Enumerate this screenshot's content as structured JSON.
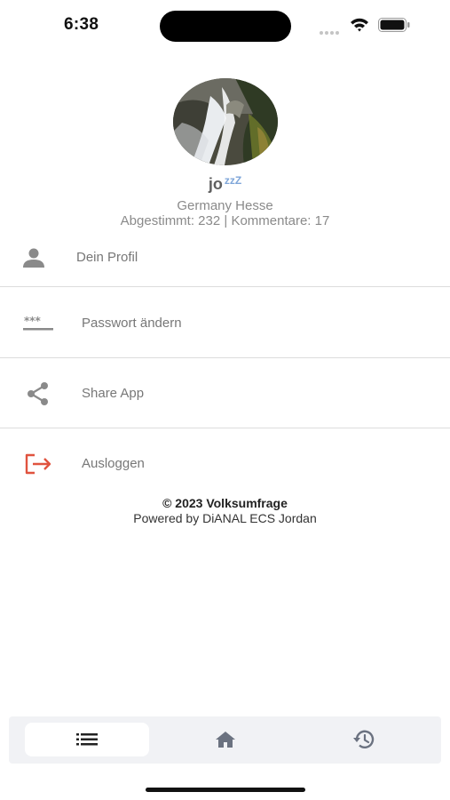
{
  "status_bar": {
    "time": "6:38"
  },
  "profile": {
    "username": "jo",
    "sleep_indicator": "zzZ",
    "location": "Germany Hesse",
    "stats": "Abgestimmt: 232 | Kommentare: 17"
  },
  "menu": {
    "items": [
      {
        "label": "Dein Profil",
        "icon": "person-icon"
      },
      {
        "label": "Passwort ändern",
        "icon": "password-icon"
      },
      {
        "label": "Share App",
        "icon": "share-icon"
      },
      {
        "label": "Ausloggen",
        "icon": "logout-icon"
      }
    ]
  },
  "footer": {
    "copyright": "© 2023 Volksumfrage",
    "powered_by": "Powered by DiANAL ECS Jordan"
  },
  "tab_bar": {
    "tabs": [
      {
        "icon": "list-icon",
        "active": true
      },
      {
        "icon": "home-icon",
        "active": false
      },
      {
        "icon": "history-icon",
        "active": false
      }
    ]
  },
  "colors": {
    "logout_accent": "#e0533f",
    "icon_gray": "#8a8a8a",
    "tab_bar_bg": "#f1f2f5"
  }
}
